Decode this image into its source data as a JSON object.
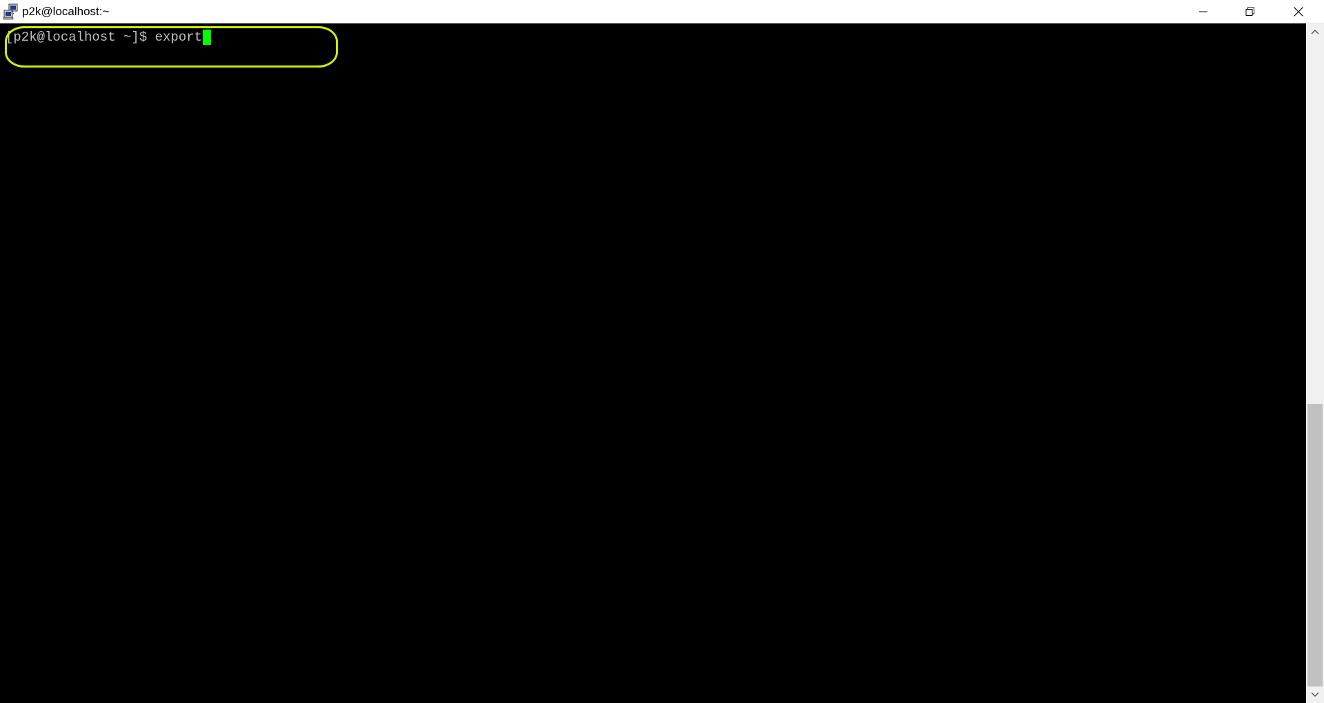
{
  "window": {
    "title": "p2k@localhost:~",
    "app_icon": "putty-icon"
  },
  "controls": {
    "minimize_icon": "minimize-icon",
    "restore_icon": "restore-icon",
    "close_icon": "close-icon"
  },
  "terminal": {
    "prompt": "[p2k@localhost ~]$ ",
    "command": "export",
    "text_color": "#c0c0c0",
    "cursor_color": "#00ff00",
    "background": "#000000",
    "highlight_color": "#c8f000"
  },
  "scrollbar": {
    "up_icon": "chevron-up-icon",
    "down_icon": "chevron-down-icon"
  }
}
